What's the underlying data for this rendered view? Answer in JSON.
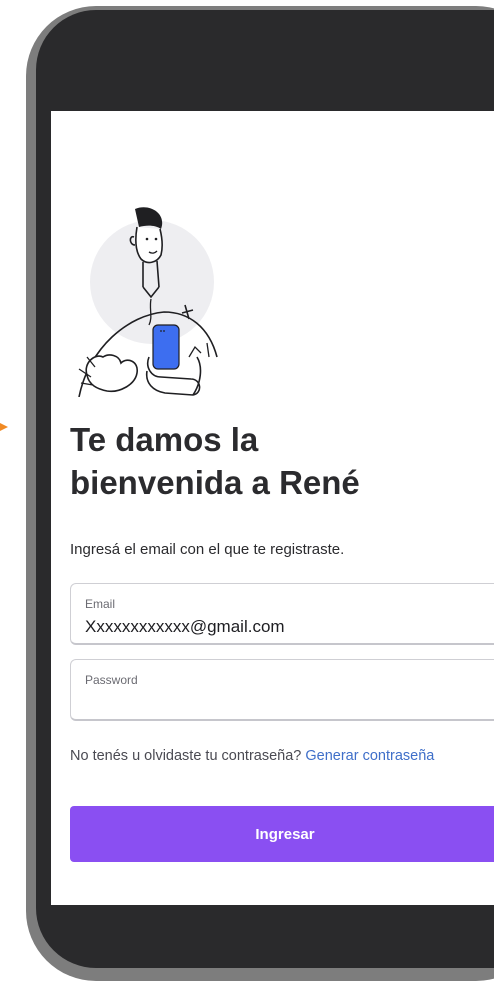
{
  "screen": {
    "title_line1": "Te damos la",
    "title_line2": "bienvenida a René",
    "subtitle": "Ingresá el email con el que te registraste."
  },
  "email_field": {
    "label": "Email",
    "value": "Xxxxxxxxxxxx@gmail.com"
  },
  "password_field": {
    "label": "Password",
    "value": ""
  },
  "help": {
    "question": "No tenés u olvidaste tu contraseña?",
    "link": "Generar contraseña"
  },
  "submit": {
    "label": "Ingresar"
  },
  "colors": {
    "accent": "#8a4ff2",
    "link": "#3f6fc9",
    "phone_body": "#2a2a2c",
    "arrow": "#f08a24",
    "illustration_phone": "#3d6ef0"
  },
  "icons": {
    "pointer": "arrow-right-icon",
    "illustration": "person-holding-phone-illustration"
  }
}
